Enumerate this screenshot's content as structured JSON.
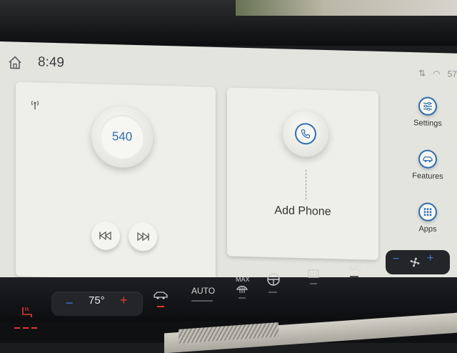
{
  "status_bar": {
    "time": "8:49",
    "right_text": "57"
  },
  "radio_card": {
    "frequency": "540"
  },
  "phone_card": {
    "label": "Add Phone"
  },
  "side_menu": {
    "items": [
      {
        "label": "Settings",
        "icon": "sliders-icon"
      },
      {
        "label": "Features",
        "icon": "car-icon"
      },
      {
        "label": "Apps",
        "icon": "grid-icon"
      }
    ]
  },
  "climate": {
    "temperature": "75°",
    "auto_label": "AUTO",
    "max_label": "MAX",
    "ac_label": "A/C"
  },
  "colors": {
    "accent": "#2f6fb0",
    "red": "#e03838",
    "blue": "#3c7de0"
  }
}
